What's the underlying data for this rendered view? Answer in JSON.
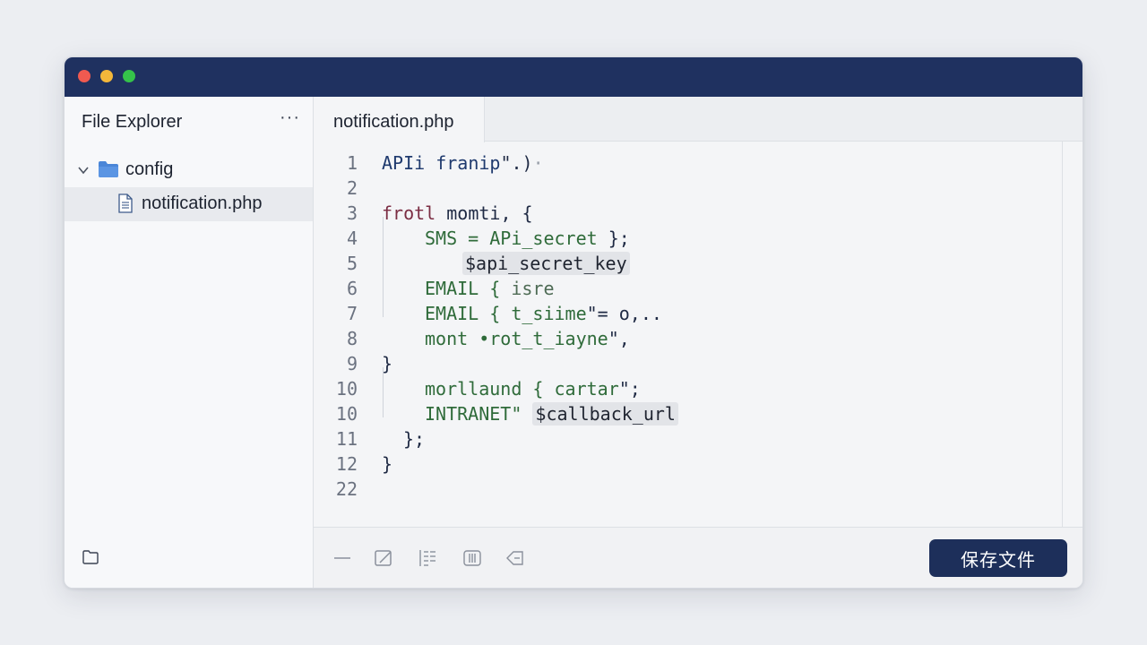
{
  "sidebar": {
    "title": "File Explorer",
    "more_label": "···",
    "tree": {
      "folder": "config",
      "file": "notification.php"
    }
  },
  "editor": {
    "tab": "notification.php",
    "lines": [
      {
        "num": "1",
        "text": "APIi franip\".)·"
      },
      {
        "num": "2",
        "text": ""
      },
      {
        "num": "3",
        "text": "frotl momti, {"
      },
      {
        "num": "4",
        "text": "SMS = APi_secret };"
      },
      {
        "num": "5",
        "text": "$api_secret_key"
      },
      {
        "num": "6",
        "text": "EMAIL { isre"
      },
      {
        "num": "7",
        "text": "EMAIL { t_siime\"= o,.."
      },
      {
        "num": "8",
        "text": "mont •rot_t_iayne\","
      },
      {
        "num": "9",
        "text": "}"
      },
      {
        "num": "10",
        "text": "morllaund { cartar\";"
      },
      {
        "num": "10",
        "text": "INTRANET\" $callback_url"
      },
      {
        "num": "11",
        "text": "};"
      },
      {
        "num": "12",
        "text": "}"
      },
      {
        "num": "22",
        "text": ""
      }
    ],
    "seg": {
      "l1a": "APIi ",
      "l1b": "franip",
      "l1c": "\".)",
      "l1d": "·",
      "l3a": "frotl",
      "l3b": " momti, {",
      "l4a": "SMS = ",
      "l4b": "APi_secret",
      "l4c": " };",
      "l5": "$api_secret_key",
      "l6a": "EMAIL { ",
      "l6b": "isre",
      "l7a": "EMAIL { ",
      "l7b": "t_siime",
      "l7c": "\"= o,..",
      "l8a": "mont ",
      "l8b": "•rot_t_iayne",
      "l8c": "\",",
      "l9": "}",
      "l10a": "morllaund { ",
      "l10b": "cartar",
      "l10c": "\";",
      "l11a": "INTRANET\" ",
      "l11b": "$callback_url",
      "l12": "};",
      "l13": "}"
    }
  },
  "toolbar": {
    "tools": [
      "minus-icon",
      "edit-icon",
      "list-icon",
      "columns-icon",
      "tag-icon"
    ],
    "save_label": "保存文件"
  },
  "colors": {
    "titlebar": "#1f3160",
    "accent_button": "#1d2f5a",
    "folder": "#4a86d8"
  }
}
